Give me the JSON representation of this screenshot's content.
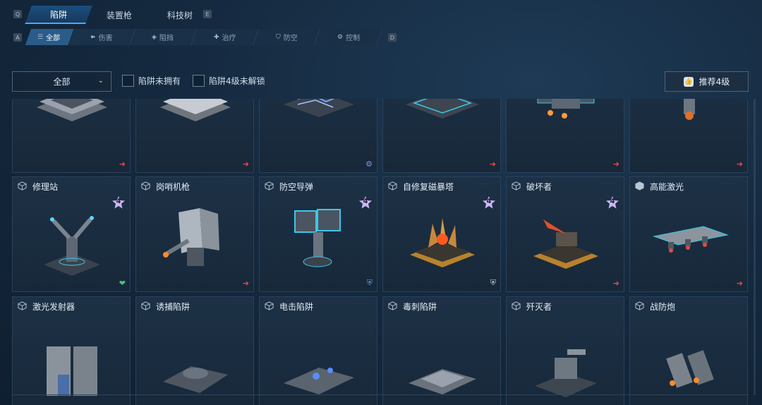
{
  "keys": {
    "left_tab": "Q",
    "right_tab": "E",
    "left_sub": "A",
    "right_sub": "D"
  },
  "top_tabs": [
    {
      "label": "陷阱",
      "sub": "",
      "active": true
    },
    {
      "label": "装置枪",
      "active": false
    },
    {
      "label": "科技树",
      "active": false
    }
  ],
  "sub_tabs": [
    {
      "label": "全部",
      "icon": "list-icon",
      "glyph": "☰",
      "active": true
    },
    {
      "label": "伤害",
      "icon": "damage-icon",
      "glyph": "➽",
      "active": false
    },
    {
      "label": "阻挡",
      "icon": "block-icon",
      "glyph": "◈",
      "active": false
    },
    {
      "label": "治疗",
      "icon": "heal-icon",
      "glyph": "✚",
      "active": false
    },
    {
      "label": "防空",
      "icon": "anti-air-icon",
      "glyph": "⛉",
      "active": false
    },
    {
      "label": "控制",
      "icon": "control-icon",
      "glyph": "⚙",
      "active": false
    }
  ],
  "filters": {
    "dropdown_value": "全部",
    "checkbox_unowned": "陷阱未拥有",
    "checkbox_locked": "陷阱4级未解锁",
    "recommend": "推荐4级"
  },
  "colors": {
    "accent": "#4aa8ff",
    "level_badge": "#c9b8f0",
    "damage_tag": "#e04a4a",
    "heal_tag": "#4fc27a"
  },
  "cards_row0": [
    {
      "corner": "arrow"
    },
    {
      "corner": "arrow"
    },
    {
      "corner": "gear"
    },
    {
      "corner": "arrow"
    },
    {
      "corner": "arrow"
    },
    {
      "corner": "arrow"
    }
  ],
  "cards_row1": [
    {
      "name": "修理站",
      "level": "4",
      "corner": "heart"
    },
    {
      "name": "岗哨机枪",
      "level": "",
      "corner": "arrow"
    },
    {
      "name": "防空导弹",
      "level": "4",
      "corner": "shield-b"
    },
    {
      "name": "自修复磁暴塔",
      "level": "4",
      "corner": "shield-w"
    },
    {
      "name": "破坏者",
      "level": "4",
      "corner": "arrow"
    },
    {
      "name": "高能激光",
      "level": "",
      "corner": "arrow"
    }
  ],
  "cards_row2": [
    {
      "name": "激光发射器",
      "level": "",
      "corner": ""
    },
    {
      "name": "诱捕陷阱",
      "level": "",
      "corner": ""
    },
    {
      "name": "电击陷阱",
      "level": "",
      "corner": ""
    },
    {
      "name": "毒刺陷阱",
      "level": "",
      "corner": ""
    },
    {
      "name": "歼灭者",
      "level": "",
      "corner": ""
    },
    {
      "name": "战防炮",
      "level": "",
      "corner": ""
    }
  ]
}
